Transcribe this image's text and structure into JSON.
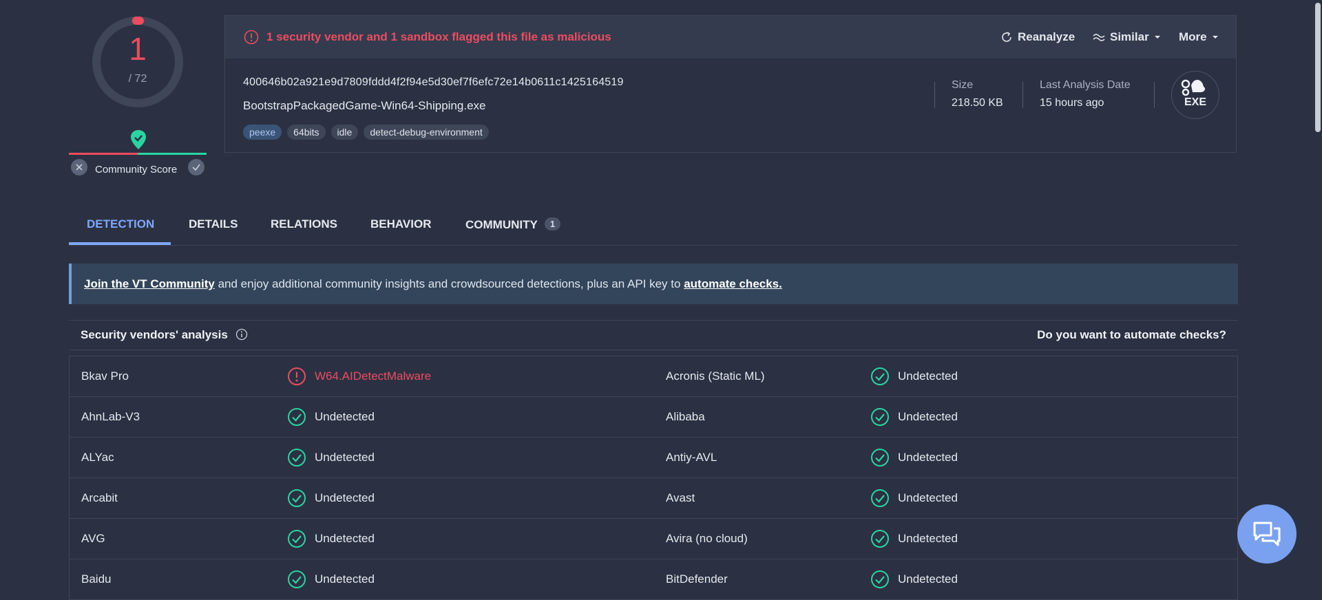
{
  "score": {
    "detections": "1",
    "total": "/ 72",
    "community_label": "Community Score"
  },
  "alert": "1 security vendor and 1 sandbox flagged this file as malicious",
  "actions": {
    "reanalyze": "Reanalyze",
    "similar": "Similar",
    "more": "More"
  },
  "file": {
    "hash": "400646b02a921e9d7809fddd4f2f94e5d30ef7f6efc72e14b0611c1425164519",
    "name": "BootstrapPackagedGame-Win64-Shipping.exe",
    "tags": [
      "peexe",
      "64bits",
      "idle",
      "detect-debug-environment"
    ],
    "size_label": "Size",
    "size_value": "218.50 KB",
    "date_label": "Last Analysis Date",
    "date_value": "15 hours ago",
    "type_badge": "EXE"
  },
  "tabs": {
    "detection": "DETECTION",
    "details": "DETAILS",
    "relations": "RELATIONS",
    "behavior": "BEHAVIOR",
    "community": "COMMUNITY",
    "community_count": "1"
  },
  "banner": {
    "link1": "Join the VT Community",
    "middle": " and enjoy additional community insights and crowdsourced detections, plus an API key to ",
    "link2": "automate checks."
  },
  "analysis": {
    "title": "Security vendors' analysis",
    "right": "Do you want to automate checks?"
  },
  "vendors": [
    {
      "left_name": "Bkav Pro",
      "left_result": "W64.AIDetectMalware",
      "left_status": "malicious",
      "right_name": "Acronis (Static ML)",
      "right_result": "Undetected"
    },
    {
      "left_name": "AhnLab-V3",
      "left_result": "Undetected",
      "left_status": "clean",
      "right_name": "Alibaba",
      "right_result": "Undetected"
    },
    {
      "left_name": "ALYac",
      "left_result": "Undetected",
      "left_status": "clean",
      "right_name": "Antiy-AVL",
      "right_result": "Undetected"
    },
    {
      "left_name": "Arcabit",
      "left_result": "Undetected",
      "left_status": "clean",
      "right_name": "Avast",
      "right_result": "Undetected"
    },
    {
      "left_name": "AVG",
      "left_result": "Undetected",
      "left_status": "clean",
      "right_name": "Avira (no cloud)",
      "right_result": "Undetected"
    },
    {
      "left_name": "Baidu",
      "left_result": "Undetected",
      "left_status": "clean",
      "right_name": "BitDefender",
      "right_result": "Undetected"
    }
  ],
  "colors": {
    "malicious": "#ec4c60",
    "clean": "#2ad4a2",
    "accent": "#7ea7ff"
  }
}
